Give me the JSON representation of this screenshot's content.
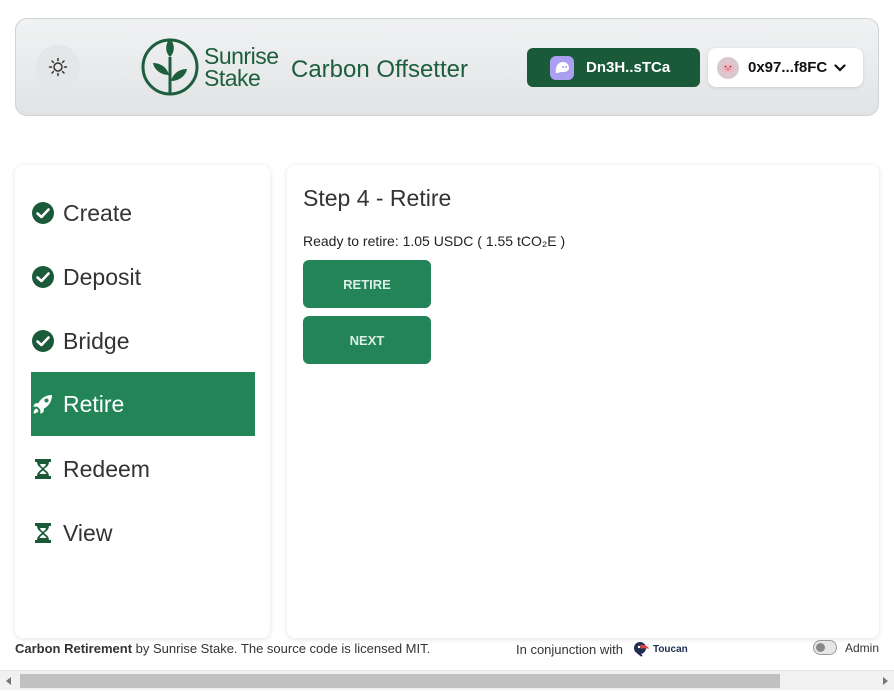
{
  "header": {
    "logo_line1": "Sunrise",
    "logo_line2": "Stake",
    "title": "Carbon Offsetter",
    "solana_wallet": "Dn3H..sTCa",
    "evm_wallet": "0x97...f8FC"
  },
  "sidebar": {
    "items": [
      {
        "label": "Create",
        "icon": "check-circle-icon",
        "active": false
      },
      {
        "label": "Deposit",
        "icon": "check-circle-icon",
        "active": false
      },
      {
        "label": "Bridge",
        "icon": "check-circle-icon",
        "active": false
      },
      {
        "label": "Retire",
        "icon": "rocket-icon",
        "active": true
      },
      {
        "label": "Redeem",
        "icon": "hourglass-icon",
        "active": false
      },
      {
        "label": "View",
        "icon": "hourglass-icon",
        "active": false
      }
    ]
  },
  "main": {
    "step_title": "Step 4 - Retire",
    "ready_text": "Ready to retire: 1.05 USDC ( 1.55 tCO₂E )",
    "retire_button": "RETIRE",
    "next_button": "NEXT"
  },
  "footer": {
    "brand": "Carbon Retirement",
    "credit": " by Sunrise Stake. The source code is licensed MIT.",
    "conjunction": "In conjunction with",
    "partner": "Toucan",
    "admin_label": "Admin"
  },
  "colors": {
    "brand_green": "#238457",
    "dark_green": "#1a5a39",
    "phantom_purple": "#ab9ff2"
  }
}
